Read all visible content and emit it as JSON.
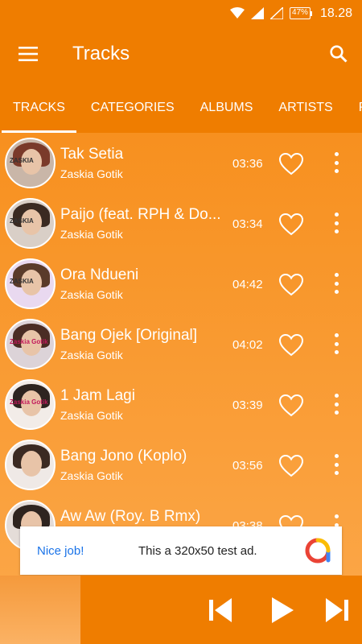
{
  "status_bar": {
    "battery": "47%",
    "time": "18.28"
  },
  "app_bar": {
    "title": "Tracks"
  },
  "tabs": [
    "TRACKS",
    "CATEGORIES",
    "ALBUMS",
    "ARTISTS",
    "P"
  ],
  "tracks": [
    {
      "title": "Tak Setia",
      "artist": "Zaskia Gotik",
      "duration": "03:36",
      "thumb_label": "ZASKIA"
    },
    {
      "title": "Paijo (feat. RPH & Do...",
      "artist": "Zaskia Gotik",
      "duration": "03:34",
      "thumb_label": "ZASKIA"
    },
    {
      "title": "Ora Ndueni",
      "artist": "Zaskia Gotik",
      "duration": "04:42",
      "thumb_label": "ZASKIA"
    },
    {
      "title": "Bang Ojek [Original]",
      "artist": "Zaskia Gotik",
      "duration": "04:02",
      "thumb_label": "Zaskia Gotik"
    },
    {
      "title": "1 Jam Lagi",
      "artist": "Zaskia Gotik",
      "duration": "03:39",
      "thumb_label": "Zaskia Gotik"
    },
    {
      "title": "Bang Jono (Koplo)",
      "artist": "Zaskia Gotik",
      "duration": "03:56",
      "thumb_label": ""
    },
    {
      "title": "Aw Aw (Roy. B Rmx)",
      "artist": "",
      "duration": "03:38",
      "thumb_label": ""
    }
  ],
  "ad": {
    "nice": "Nice job!",
    "text": "This a 320x50 test ad."
  },
  "colors": {
    "primary": "#ef7d00",
    "list_top": "#f7901f",
    "list_bottom": "#fba545",
    "ad_link": "#1a73e8"
  },
  "icons": [
    "wifi-icon",
    "signal-icon",
    "battery-icon",
    "menu-icon",
    "search-icon",
    "heart-icon",
    "more-vert-icon",
    "skip-previous-icon",
    "play-icon",
    "skip-next-icon"
  ]
}
